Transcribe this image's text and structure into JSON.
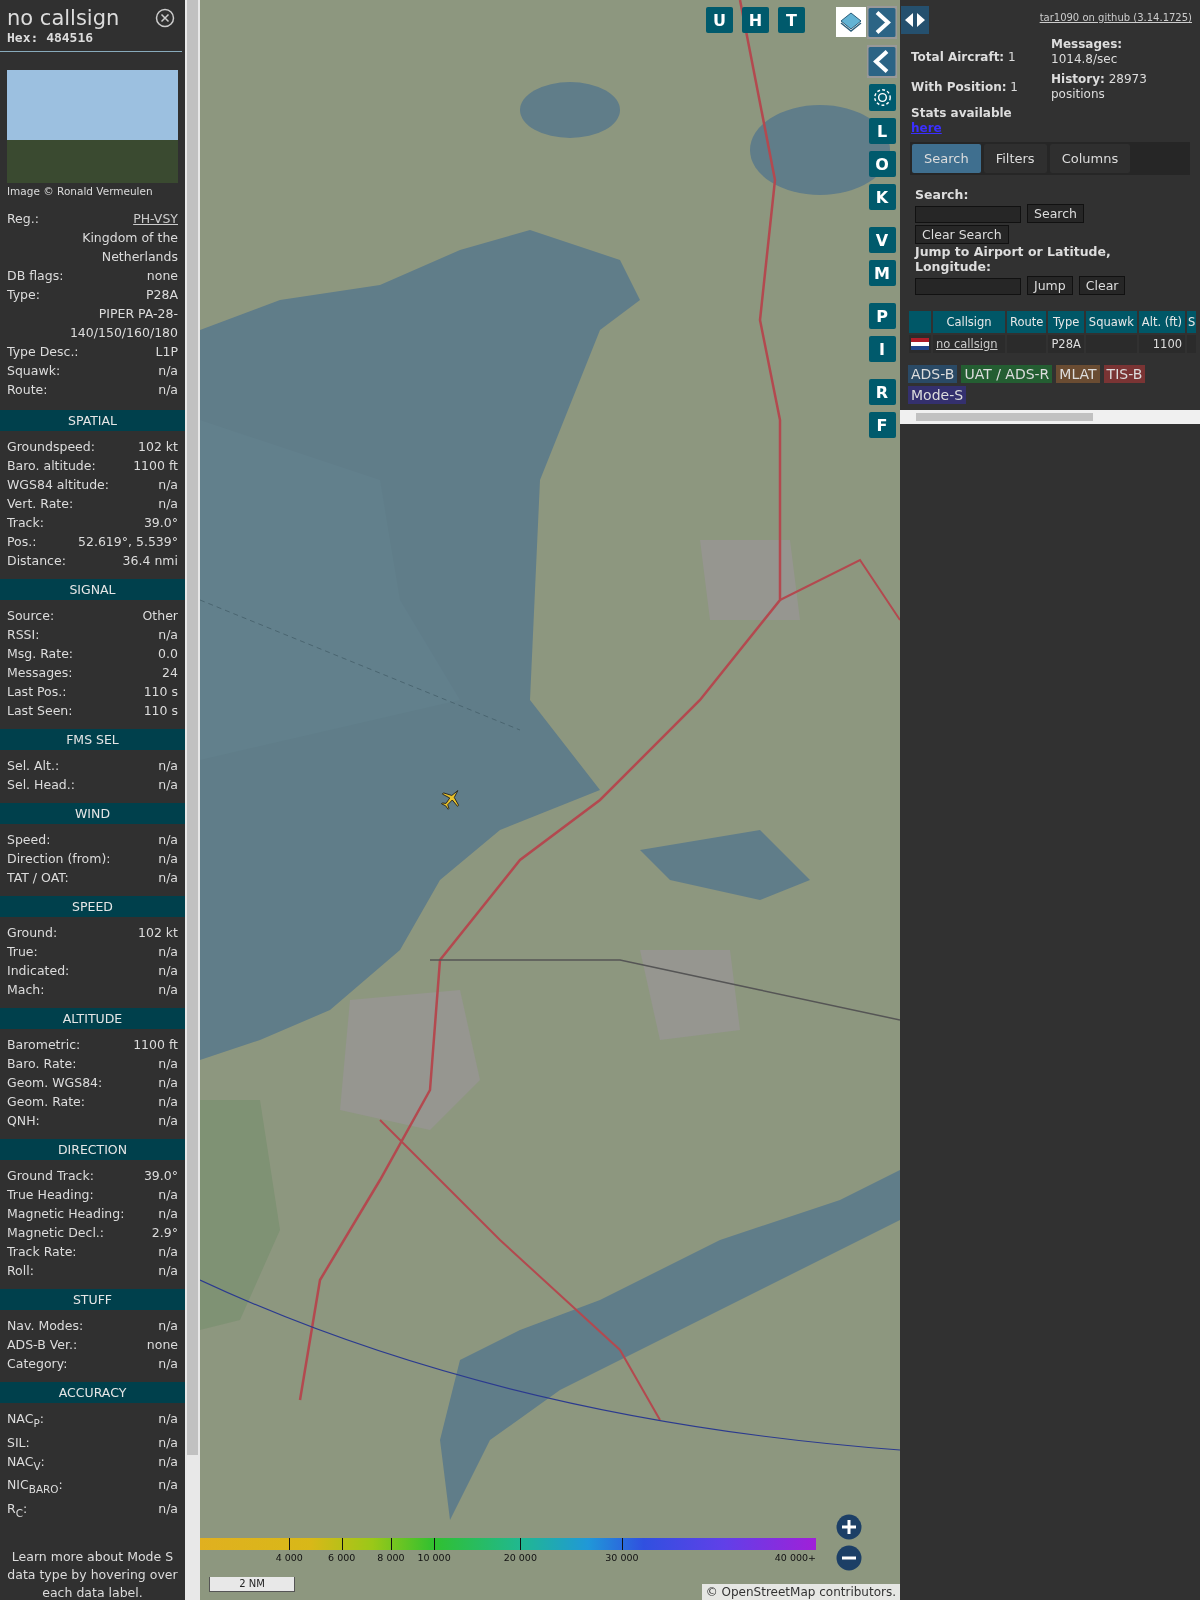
{
  "detail": {
    "callsign": "no callsign",
    "hex_label": "Hex:",
    "hex": "484516",
    "photo_credit": "Image © Ronald Vermeulen",
    "rows": [
      {
        "kind": "link",
        "label": "Reg.:",
        "value": "PH-VSY"
      },
      {
        "kind": "text",
        "value": "Kingdom of the Netherlands"
      },
      {
        "kind": "text",
        "label": "DB flags:",
        "value": "none"
      },
      {
        "kind": "text",
        "label": "Type:",
        "value": "P28A"
      },
      {
        "kind": "text",
        "value": "PIPER PA-28-140/150/160/180"
      },
      {
        "kind": "text",
        "label": "Type Desc.:",
        "value": "L1P"
      },
      {
        "kind": "text",
        "label": "Squawk:",
        "value": "n/a"
      },
      {
        "kind": "text",
        "label": "Route:",
        "value": "n/a"
      }
    ],
    "sections": [
      {
        "title": "SPATIAL",
        "rows": [
          {
            "label": "Groundspeed:",
            "value": "102 kt"
          },
          {
            "label": "Baro. altitude:",
            "value": "1100 ft"
          },
          {
            "label": "WGS84 altitude:",
            "value": "n/a"
          },
          {
            "label": "Vert. Rate:",
            "value": "n/a"
          },
          {
            "label": "Track:",
            "value": "39.0°"
          },
          {
            "label": "Pos.:",
            "value": "52.619°, 5.539°"
          },
          {
            "label": "Distance:",
            "value": "36.4 nmi"
          }
        ]
      },
      {
        "title": "SIGNAL",
        "rows": [
          {
            "label": "Source:",
            "value": "Other"
          },
          {
            "label": "RSSI:",
            "value": "n/a"
          },
          {
            "label": "Msg. Rate:",
            "value": "0.0"
          },
          {
            "label": "Messages:",
            "value": "24"
          },
          {
            "label": "Last Pos.:",
            "value": "110 s"
          },
          {
            "label": "Last Seen:",
            "value": "110 s"
          }
        ]
      },
      {
        "title": "FMS SEL",
        "rows": [
          {
            "label": "Sel. Alt.:",
            "value": "n/a"
          },
          {
            "label": "Sel. Head.:",
            "value": "n/a"
          }
        ]
      },
      {
        "title": "WIND",
        "rows": [
          {
            "label": "Speed:",
            "value": "n/a"
          },
          {
            "label": "Direction (from):",
            "value": "n/a"
          },
          {
            "label": "TAT / OAT:",
            "value": "n/a"
          }
        ]
      },
      {
        "title": "SPEED",
        "rows": [
          {
            "label": "Ground:",
            "value": "102 kt"
          },
          {
            "label": "True:",
            "value": "n/a"
          },
          {
            "label": "Indicated:",
            "value": "n/a"
          },
          {
            "label": "Mach:",
            "value": "n/a"
          }
        ]
      },
      {
        "title": "ALTITUDE",
        "rows": [
          {
            "label": "Barometric:",
            "value": "1100 ft"
          },
          {
            "label": "Baro. Rate:",
            "value": "n/a"
          },
          {
            "label": "Geom. WGS84:",
            "value": "n/a"
          },
          {
            "label": "Geom. Rate:",
            "value": "n/a"
          },
          {
            "label": "QNH:",
            "value": "n/a"
          }
        ]
      },
      {
        "title": "DIRECTION",
        "rows": [
          {
            "label": "Ground Track:",
            "value": "39.0°"
          },
          {
            "label": "True Heading:",
            "value": "n/a"
          },
          {
            "label": "Magnetic Heading:",
            "value": "n/a"
          },
          {
            "label": "Magnetic Decl.:",
            "value": "2.9°"
          },
          {
            "label": "Track Rate:",
            "value": "n/a"
          },
          {
            "label": "Roll:",
            "value": "n/a"
          }
        ]
      },
      {
        "title": "STUFF",
        "rows": [
          {
            "label": "Nav. Modes:",
            "value": "n/a"
          },
          {
            "label": "ADS-B Ver.:",
            "value": "none"
          },
          {
            "label": "Category:",
            "value": "n/a"
          }
        ]
      },
      {
        "title": "ACCURACY",
        "rows": [
          {
            "label": "NAC$_{P}$:",
            "value": "n/a"
          },
          {
            "label": "SIL:",
            "value": "n/a"
          },
          {
            "label": "NAC$_{V}$:",
            "value": "n/a"
          },
          {
            "label": "NIC$_{BARO}$:",
            "value": "n/a"
          },
          {
            "label": "R$_{C}$:",
            "value": "n/a"
          }
        ]
      }
    ],
    "note": "Learn more about Mode S data type by hovering over each data label."
  },
  "map": {
    "top_buttons": [
      "U",
      "H",
      "T"
    ],
    "side_buttons": [
      "L",
      "O",
      "K",
      "V",
      "M",
      "P",
      "I",
      "R",
      "F"
    ],
    "altitude_legend": [
      "4 000",
      "6 000",
      "8 000",
      "10 000",
      "20 000",
      "30 000",
      "40 000+"
    ],
    "scale": "2 NM",
    "attribution": "© OpenStreetMap contributors."
  },
  "panel": {
    "github_link": "tar1090 on github (3.14.1725)",
    "stats_left": [
      {
        "label": "Total Aircraft:",
        "value": "1"
      },
      {
        "label": "With Position:",
        "value": "1"
      }
    ],
    "stats_link_label": "Stats available",
    "stats_link": "here",
    "stats_right": [
      {
        "label": "Messages:",
        "value": "1014.8/sec"
      },
      {
        "label": "History:",
        "value": "28973 positions"
      }
    ],
    "tabs": [
      {
        "label": "Search",
        "selected": true
      },
      {
        "label": "Filters",
        "selected": false
      },
      {
        "label": "Columns",
        "selected": false
      }
    ],
    "search_label": "Search:",
    "search_button": "Search",
    "clear_search_button": "Clear Search",
    "jump_label": "Jump to Airport or Latitude, Longitude:",
    "jump_button": "Jump",
    "clear_button": "Clear",
    "table": {
      "columns": [
        "Callsign",
        "Route",
        "Type",
        "Squawk",
        "Alt. (ft)",
        "S"
      ],
      "rows": [
        {
          "callsign": "no callsign",
          "type": "P28A",
          "altitude": "1100"
        }
      ]
    },
    "legend": [
      {
        "label": "ADS-B",
        "color": "#2a4a66"
      },
      {
        "label": "UAT / ADS-R",
        "color": "#245e32"
      },
      {
        "label": "MLAT",
        "color": "#6a4c32"
      },
      {
        "label": "TIS-B",
        "color": "#7a3434"
      },
      {
        "label": "Mode-S",
        "color": "#34306e"
      }
    ]
  }
}
